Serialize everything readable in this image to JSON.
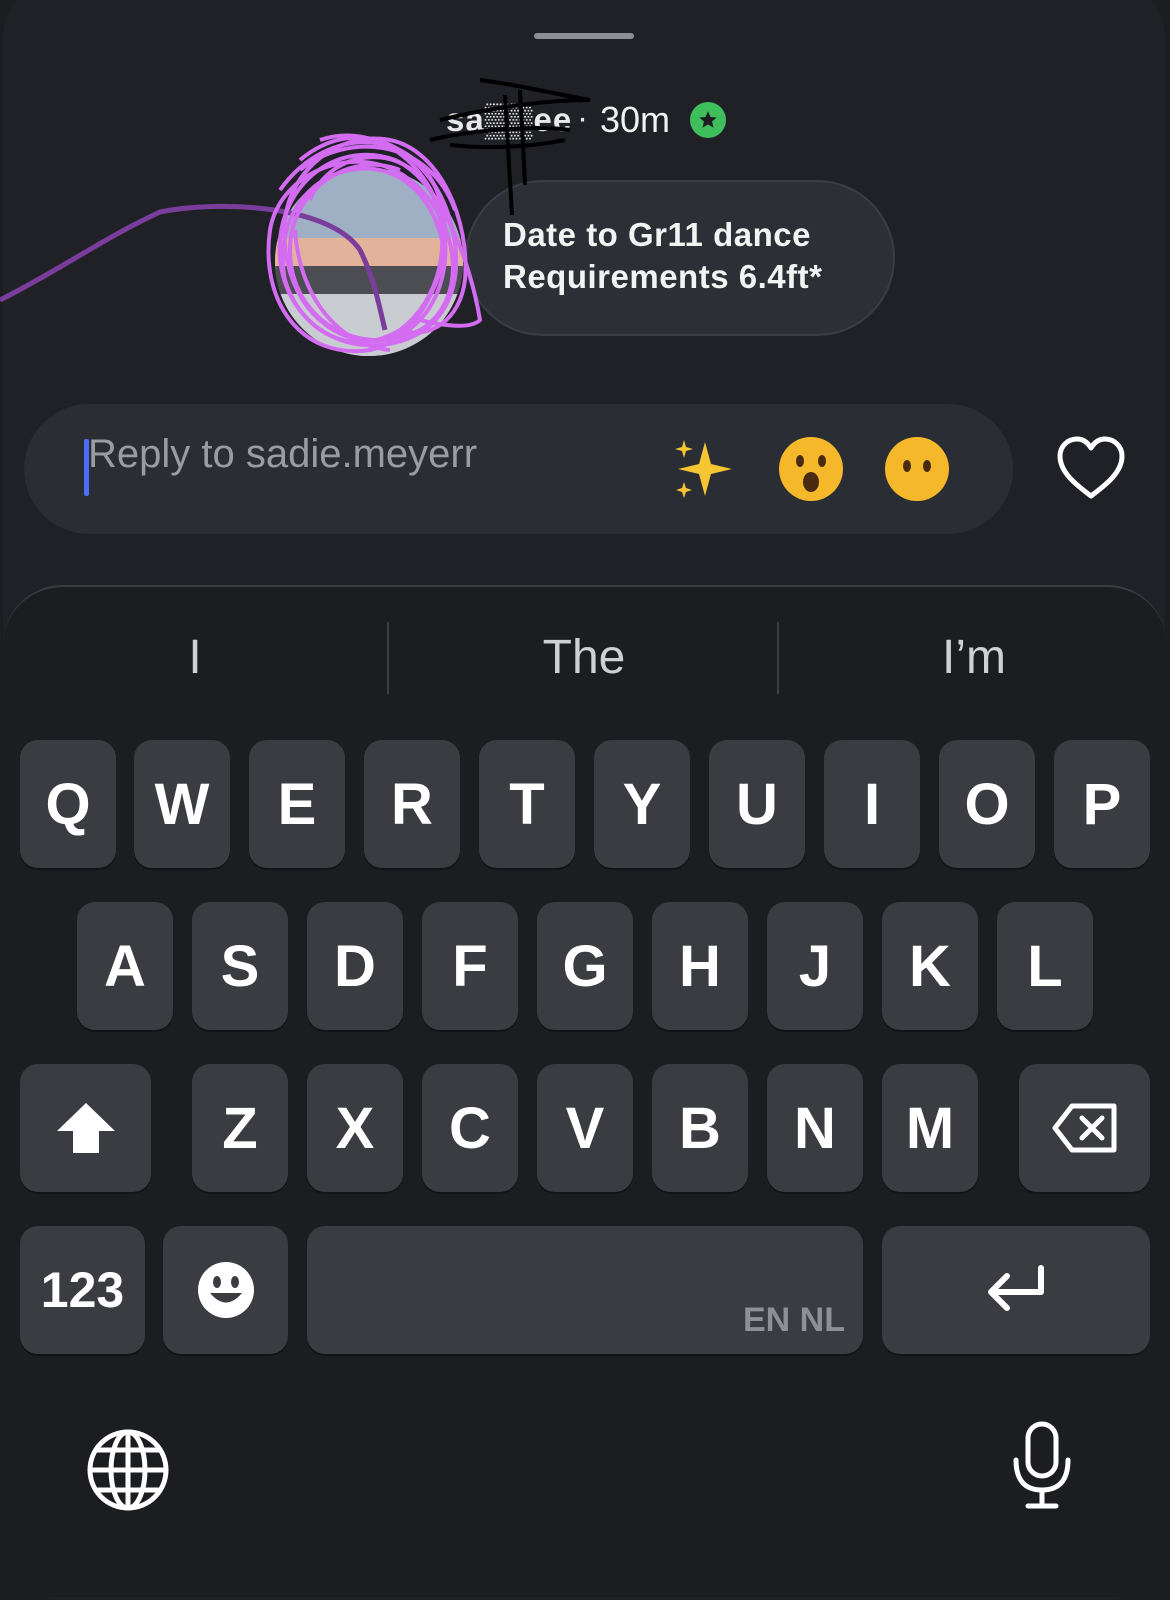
{
  "story_header": {
    "username": "sa▒▒ee",
    "separator": "·",
    "time": "30m",
    "close_friends_badge": "green-star-badge"
  },
  "message_bubble": {
    "line1": "Date to Gr11 dance",
    "line2": "Requirements 6.4ft*"
  },
  "reply_bar": {
    "placeholder": "Reply to sadie.meyerr",
    "reactions": [
      "✨",
      "😮",
      "😶"
    ],
    "like_icon": "heart-icon"
  },
  "suggestions": [
    "I",
    "The",
    "I’m"
  ],
  "keyboard": {
    "row1": [
      "Q",
      "W",
      "E",
      "R",
      "T",
      "Y",
      "U",
      "I",
      "O",
      "P"
    ],
    "row2": [
      "A",
      "S",
      "D",
      "F",
      "G",
      "H",
      "J",
      "K",
      "L"
    ],
    "row3": [
      "Z",
      "X",
      "C",
      "V",
      "B",
      "N",
      "M"
    ],
    "numbers_key": "123",
    "space_languages": "EN NL"
  },
  "colors": {
    "background": "#1b1d21",
    "key": "#3a3c41",
    "badge_green": "#3fbf5b",
    "caret": "#4b6ef5",
    "scribble_purple": "#d36cf0"
  }
}
